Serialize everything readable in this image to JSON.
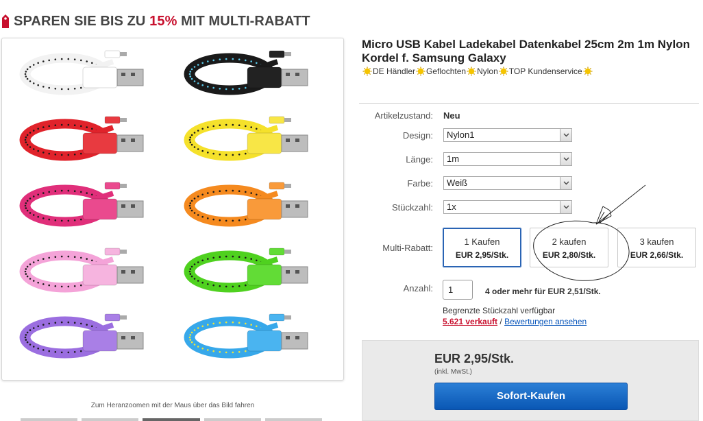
{
  "banner": {
    "prefix": "SPAREN SIE BIS ZU ",
    "percent": "15%",
    "suffix": " MIT MULTI-RABATT"
  },
  "product_image": {
    "cable_colors": [
      {
        "cable": "#f2f2f2",
        "dots": "#222222",
        "plug": "#ffffff"
      },
      {
        "cable": "#1a1a1a",
        "dots": "#5bc8e8",
        "plug": "#222222"
      },
      {
        "cable": "#e0232b",
        "dots": "#1a1a1a",
        "plug": "#e83a40"
      },
      {
        "cable": "#f5e12b",
        "dots": "#1a1a1a",
        "plug": "#f8e646"
      },
      {
        "cable": "#e02f7a",
        "dots": "#1a1a1a",
        "plug": "#ea4a8e"
      },
      {
        "cable": "#f58a1f",
        "dots": "#1a1a1a",
        "plug": "#f99a3a"
      },
      {
        "cable": "#f4a3d8",
        "dots": "#1a1a1a",
        "plug": "#f6b4df"
      },
      {
        "cable": "#4fd11f",
        "dots": "#1a1a1a",
        "plug": "#62dc36"
      },
      {
        "cable": "#9b6ee0",
        "dots": "#1a1a1a",
        "plug": "#a97fe6"
      },
      {
        "cable": "#37a8ea",
        "dots": "#f0e53a",
        "plug": "#4ab4f0"
      }
    ],
    "zoom_hint": "Zum Heranzoomen mit der Maus über das Bild fahren"
  },
  "title": "Micro USB Kabel Ladekabel Datenkabel 25cm 2m 1m Nylon Kordel f. Samsung Galaxy",
  "features": [
    "DE Händler",
    "Geflochten",
    "Nylon",
    "TOP Kundenservice"
  ],
  "condition": {
    "label": "Artikelzustand:",
    "value": "Neu"
  },
  "design": {
    "label": "Design:",
    "value": "Nylon1"
  },
  "length": {
    "label": "Länge:",
    "value": "1m"
  },
  "color": {
    "label": "Farbe:",
    "value": "Weiß"
  },
  "quantity_select": {
    "label": "Stückzahl:",
    "value": "1x"
  },
  "multi_rabatt": {
    "label": "Multi-Rabatt:",
    "options": [
      {
        "qty": "1 Kaufen",
        "price": "EUR 2,95/Stk."
      },
      {
        "qty": "2 kaufen",
        "price": "EUR 2,80/Stk."
      },
      {
        "qty": "3 kaufen",
        "price": "EUR 2,66/Stk."
      }
    ]
  },
  "amount": {
    "label": "Anzahl:",
    "value": "1",
    "bulk_note": "4 oder mehr für EUR 2,51/Stk."
  },
  "availability": {
    "limited": "Begrenzte Stückzahl verfügbar",
    "sold": "5.621 verkauft",
    "separator": " / ",
    "reviews": "Bewertungen ansehen"
  },
  "buy": {
    "price": "EUR 2,95/Stk.",
    "tax": "(inkl. MwSt.)",
    "button": "Sofort-Kaufen"
  },
  "colors": {
    "accent_red": "#c8102e",
    "link_blue": "#0654ba",
    "buy_button": "#0a57b4",
    "selected_border": "#2a64b4",
    "feature_star": "#f5c400"
  }
}
